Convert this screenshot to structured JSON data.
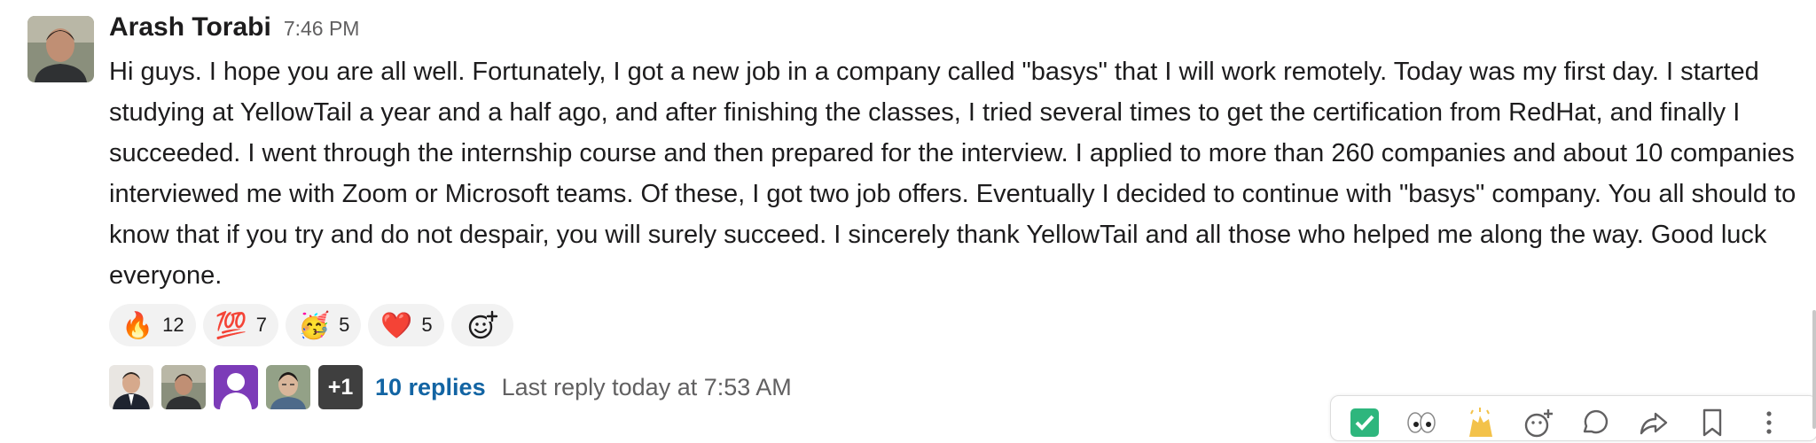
{
  "message": {
    "author": "Arash Torabi",
    "timestamp": "7:46 PM",
    "body": "Hi guys. I hope you are all well.  Fortunately, I got a new job in a company called \"basys\" that I will work remotely. Today was my first day. I started studying at YellowTail a year and a half ago, and after finishing the classes, I tried several times to get the certification from RedHat, and finally I succeeded. I went through the internship course and then prepared for the interview. I applied to more than 260 companies and about 10 companies interviewed me with Zoom or Microsoft teams. Of these, I got two job offers. Eventually I decided to continue with \"basys\" company. You all should to know that if you try and do not despair, you will surely succeed. I sincerely thank YellowTail and all those who helped me along the way. Good luck everyone."
  },
  "reactions": [
    {
      "emoji": "🔥",
      "icon": "fire-emoji",
      "count": "12"
    },
    {
      "emoji": "💯",
      "icon": "hundred-points-emoji",
      "count": "7"
    },
    {
      "emoji": "🥳",
      "icon": "partying-face-emoji",
      "count": "5"
    },
    {
      "emoji": "❤️",
      "icon": "red-heart-emoji",
      "count": "5"
    }
  ],
  "add_reaction_icon": "add-reaction-icon",
  "thread": {
    "more_count": "+1",
    "replies": "10 replies",
    "last_reply": "Last reply today at 7:53 AM"
  },
  "colors": {
    "link": "#1264a3",
    "muted": "#616061",
    "text": "#1d1c1d",
    "reaction_bg": "#f2f2f2"
  }
}
